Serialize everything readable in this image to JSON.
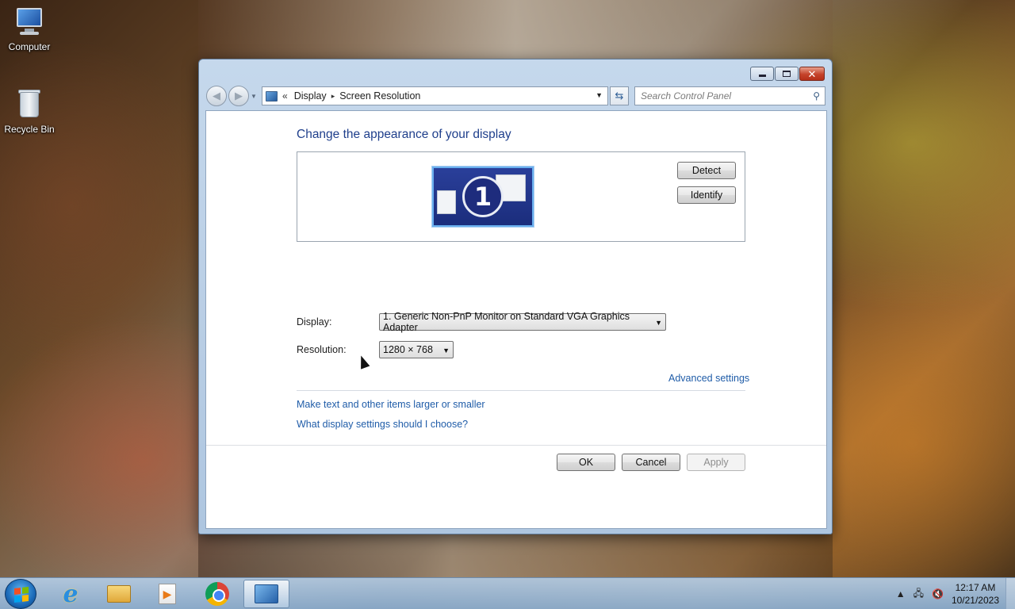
{
  "desktop": {
    "icons": [
      {
        "label": "Computer",
        "icon": "computer-icon"
      },
      {
        "label": "Recycle Bin",
        "icon": "recycle-bin-icon"
      }
    ]
  },
  "window": {
    "nav": {
      "breadcrumb_prefix": "«",
      "crumbs": [
        "Display",
        "Screen Resolution"
      ],
      "crumb_separator": "▸",
      "search_placeholder": "Search Control Panel"
    },
    "heading": "Change the appearance of your display",
    "monitor": {
      "number": "1"
    },
    "detect_label": "Detect",
    "identify_label": "Identify",
    "display_label": "Display:",
    "display_value": "1. Generic Non-PnP Monitor on Standard VGA Graphics Adapter",
    "resolution_label": "Resolution:",
    "resolution_value": "1280 × 768",
    "advanced_link": "Advanced settings",
    "links": [
      "Make text and other items larger or smaller",
      "What display settings should I choose?"
    ],
    "ok_label": "OK",
    "cancel_label": "Cancel",
    "apply_label": "Apply"
  },
  "taskbar": {
    "apps": [
      "internet-explorer-icon",
      "windows-explorer-icon",
      "media-player-icon",
      "chrome-icon",
      "control-panel-icon"
    ],
    "active_app": "control-panel-icon",
    "clock_time": "12:17 AM",
    "clock_date": "10/21/2023"
  },
  "colors": {
    "link": "#1f5ca8",
    "heading": "#1f3f8c",
    "close_button": "#c5432b"
  }
}
